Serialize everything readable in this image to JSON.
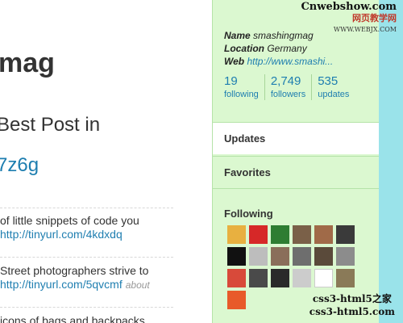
{
  "main": {
    "title": "mag",
    "post_title": "Best Post in",
    "post_link": "7z6g",
    "tweets": [
      {
        "text": "of little snippets of code you",
        "link": "http://tinyurl.com/4kdxdq",
        "meta": ""
      },
      {
        "text": "Street photographers strive to",
        "link": "http://tinyurl.com/5qvcmf",
        "meta": "about"
      },
      {
        "text": "icons of bags and backpacks",
        "link": "",
        "meta": ""
      }
    ]
  },
  "sidebar": {
    "profile": {
      "name_label": "Name",
      "name_value": "smashingmag",
      "location_label": "Location",
      "location_value": "Germany",
      "web_label": "Web",
      "web_value": "http://www.smashi..."
    },
    "stats": [
      {
        "num": "19",
        "label": "following"
      },
      {
        "num": "2,749",
        "label": "followers"
      },
      {
        "num": "535",
        "label": "updates"
      }
    ],
    "menu": [
      {
        "label": "Updates",
        "active": true
      },
      {
        "label": "Favorites",
        "active": false
      }
    ],
    "following_label": "Following",
    "avatar_colors": [
      "#e8b040",
      "#d62828",
      "#2e7d32",
      "#7a6048",
      "#a06a48",
      "#3a3a3a",
      "#111111",
      "#bdbdbd",
      "#8a6e5a",
      "#6e6e6e",
      "#5a4a3a",
      "#8c8c8c",
      "#d84a3a",
      "#4a4a4a",
      "#2a2a2a",
      "#cccccc",
      "#ffffff",
      "#8a7a58",
      "#e85a2a"
    ]
  },
  "watermarks": {
    "top_main": "Cnwebshow.com",
    "top_sub": "网页教学网",
    "top_tiny": "WWW.WEBJX.COM",
    "bottom_line1": "css3-html5之家",
    "bottom_line2": "css3-html5.com"
  }
}
